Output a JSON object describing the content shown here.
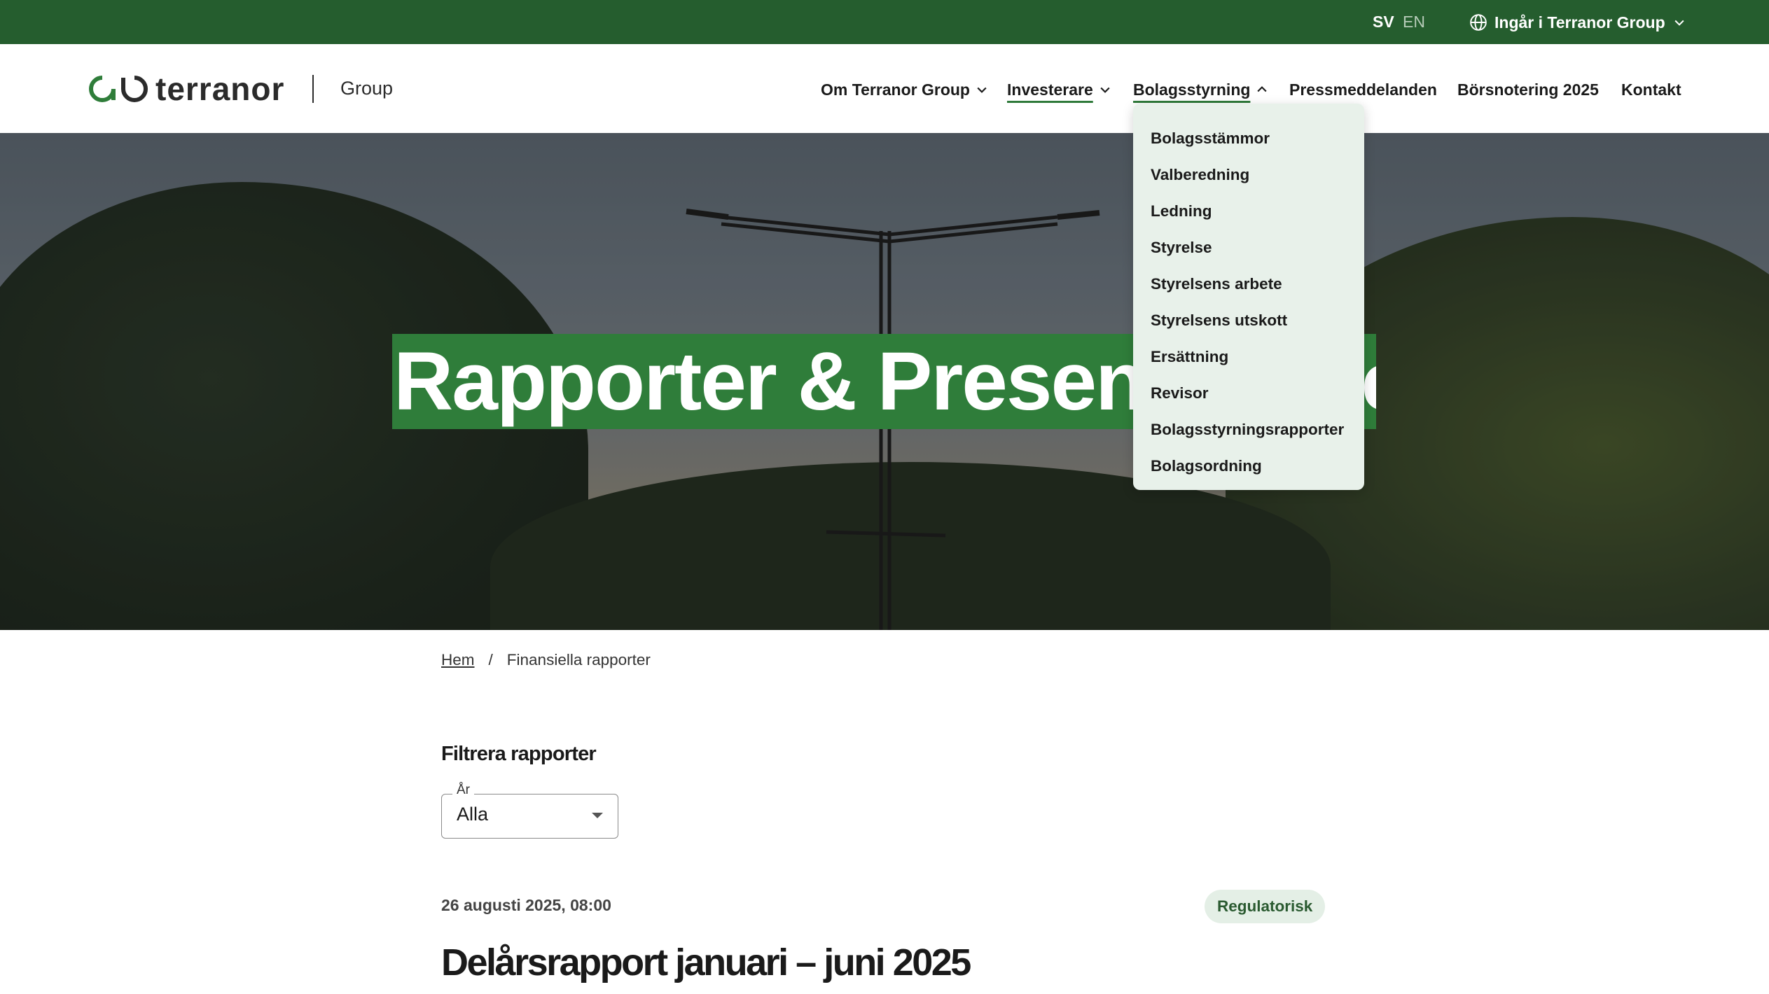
{
  "topbar": {
    "lang_sv": "SV",
    "lang_en": "EN",
    "group_link": "Ingår i Terranor Group"
  },
  "header": {
    "logo_text": "terranor",
    "logo_suffix": "Group",
    "nav": [
      {
        "label": "Om Terranor Group",
        "has_chevron": true
      },
      {
        "label": "Investerare",
        "has_chevron": true
      },
      {
        "label": "Bolagsstyrning",
        "has_chevron": true,
        "open": true
      },
      {
        "label": "Pressmeddelanden"
      },
      {
        "label": "Börsnotering 2025"
      },
      {
        "label": "Kontakt"
      }
    ]
  },
  "dropdown": {
    "items": [
      "Bolagsstämmor",
      "Valberedning",
      "Ledning",
      "Styrelse",
      "Styrelsens arbete",
      "Styrelsens utskott",
      "Ersättning",
      "Revisor",
      "Bolagsstyrningsrapporter",
      "Bolagsordning"
    ]
  },
  "hero": {
    "title": "Rapporter & Presentationer"
  },
  "breadcrumb": {
    "home": "Hem",
    "separator": "/",
    "current": "Finansiella rapporter"
  },
  "filter": {
    "title": "Filtrera rapporter",
    "year_label": "År",
    "year_value": "Alla"
  },
  "report": {
    "date": "26 augusti 2025, 08:00",
    "badge": "Regulatorisk",
    "title": "Delårsrapport januari – juni 2025"
  },
  "colors": {
    "brand_green": "#255d2e",
    "accent_green": "#2f7d3a",
    "dropdown_bg": "#e8f1ea"
  }
}
